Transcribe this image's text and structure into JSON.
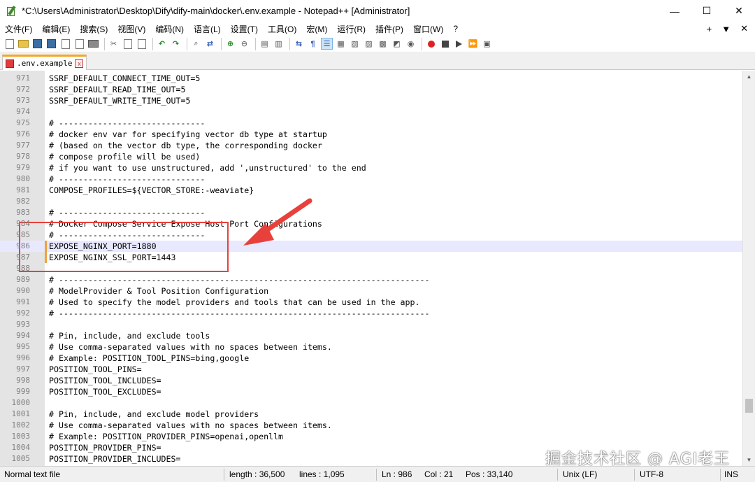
{
  "window": {
    "title": "*C:\\Users\\Administrator\\Desktop\\Dify\\dify-main\\docker\\.env.example - Notepad++ [Administrator]",
    "minimize": "—",
    "maximize": "☐",
    "close": "✕"
  },
  "menu": {
    "items": [
      "文件(F)",
      "编辑(E)",
      "搜索(S)",
      "视图(V)",
      "编码(N)",
      "语言(L)",
      "设置(T)",
      "工具(O)",
      "宏(M)",
      "运行(R)",
      "插件(P)",
      "窗口(W)",
      "?"
    ],
    "plus": "+",
    "dropdown": "▼",
    "close": "✕"
  },
  "tab": {
    "label": ".env.example",
    "close": "x"
  },
  "editor": {
    "lines": [
      {
        "n": "971",
        "text": "SSRF_DEFAULT_CONNECT_TIME_OUT=5"
      },
      {
        "n": "972",
        "text": "SSRF_DEFAULT_READ_TIME_OUT=5"
      },
      {
        "n": "973",
        "text": "SSRF_DEFAULT_WRITE_TIME_OUT=5"
      },
      {
        "n": "974",
        "text": ""
      },
      {
        "n": "975",
        "text": "# ------------------------------"
      },
      {
        "n": "976",
        "text": "# docker env var for specifying vector db type at startup"
      },
      {
        "n": "977",
        "text": "# (based on the vector db type, the corresponding docker"
      },
      {
        "n": "978",
        "text": "# compose profile will be used)"
      },
      {
        "n": "979",
        "text": "# if you want to use unstructured, add ',unstructured' to the end"
      },
      {
        "n": "980",
        "text": "# ------------------------------"
      },
      {
        "n": "981",
        "text": "COMPOSE_PROFILES=${VECTOR_STORE:-weaviate}"
      },
      {
        "n": "982",
        "text": ""
      },
      {
        "n": "983",
        "text": "# ------------------------------"
      },
      {
        "n": "984",
        "text": "# Docker Compose Service Expose Host Port Configurations"
      },
      {
        "n": "985",
        "text": "# ------------------------------"
      },
      {
        "n": "986",
        "text": "EXPOSE_NGINX_PORT=1880"
      },
      {
        "n": "987",
        "text": "EXPOSE_NGINX_SSL_PORT=1443"
      },
      {
        "n": "988",
        "text": ""
      },
      {
        "n": "989",
        "text": "# ----------------------------------------------------------------------------"
      },
      {
        "n": "990",
        "text": "# ModelProvider & Tool Position Configuration"
      },
      {
        "n": "991",
        "text": "# Used to specify the model providers and tools that can be used in the app."
      },
      {
        "n": "992",
        "text": "# ----------------------------------------------------------------------------"
      },
      {
        "n": "993",
        "text": ""
      },
      {
        "n": "994",
        "text": "# Pin, include, and exclude tools"
      },
      {
        "n": "995",
        "text": "# Use comma-separated values with no spaces between items."
      },
      {
        "n": "996",
        "text": "# Example: POSITION_TOOL_PINS=bing,google"
      },
      {
        "n": "997",
        "text": "POSITION_TOOL_PINS="
      },
      {
        "n": "998",
        "text": "POSITION_TOOL_INCLUDES="
      },
      {
        "n": "999",
        "text": "POSITION_TOOL_EXCLUDES="
      },
      {
        "n": "1000",
        "text": ""
      },
      {
        "n": "1001",
        "text": "# Pin, include, and exclude model providers"
      },
      {
        "n": "1002",
        "text": "# Use comma-separated values with no spaces between items."
      },
      {
        "n": "1003",
        "text": "# Example: POSITION_PROVIDER_PINS=openai,openllm"
      },
      {
        "n": "1004",
        "text": "POSITION_PROVIDER_PINS="
      },
      {
        "n": "1005",
        "text": "POSITION_PROVIDER_INCLUDES="
      }
    ]
  },
  "scrollbar": {
    "up": "▲",
    "down": "▼"
  },
  "watermark": "掘金技术社区 @ AGI老王",
  "status": {
    "file_type": "Normal text file",
    "length": "length : 36,500",
    "lines": "lines : 1,095",
    "ln": "Ln : 986",
    "col": "Col : 21",
    "pos": "Pos : 33,140",
    "eol": "Unix (LF)",
    "encoding": "UTF-8",
    "mode": "INS"
  },
  "colors": {
    "highlight_box": "#e8413c",
    "arrow": "#e8413c",
    "current_line": "#e8e8ff",
    "change_marker": "#f2a13a"
  }
}
